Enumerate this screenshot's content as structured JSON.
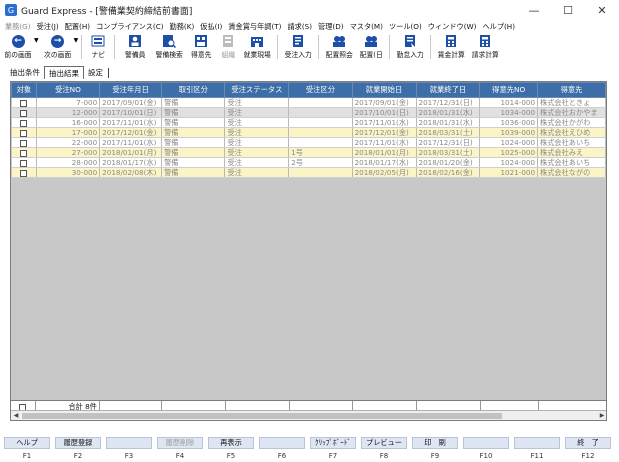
{
  "window": {
    "title": "Guard Express - [警備業契約締結前書面]",
    "controls": [
      "—",
      "☐",
      "✕"
    ]
  },
  "menu": [
    {
      "label": "業務(G)",
      "disabled": true
    },
    {
      "label": "受注(J)",
      "disabled": false
    },
    {
      "label": "配置(H)",
      "disabled": false
    },
    {
      "label": "コンプライアンス(C)",
      "disabled": false
    },
    {
      "label": "勤務(K)",
      "disabled": false
    },
    {
      "label": "仮払(I)",
      "disabled": false
    },
    {
      "label": "賃金賞与年調(T)",
      "disabled": false
    },
    {
      "label": "請求(S)",
      "disabled": false
    },
    {
      "label": "管理(D)",
      "disabled": false
    },
    {
      "label": "マスタ(M)",
      "disabled": false
    },
    {
      "label": "ツール(O)",
      "disabled": false
    },
    {
      "label": "ウィンドウ(W)",
      "disabled": false
    },
    {
      "label": "ヘルプ(H)",
      "disabled": false
    }
  ],
  "toolbar": {
    "back": "前の画面",
    "forward": "次の画面",
    "navi": "ナビ",
    "guard": "警備員",
    "guard_search": "警備検索",
    "client": "得意先",
    "chart": "組織",
    "site": "就業現場",
    "order_entry": "受注入力",
    "assignment_view": "配置照会",
    "assignment_day": "配置(日",
    "attendance_entry": "勤怠入力",
    "wage_calc": "賃金計算",
    "billing_calc": "請求計算"
  },
  "tabs": {
    "conditions": "抽出条件",
    "results": "抽出結果",
    "settings": "設定"
  },
  "table": {
    "columns": [
      "対象",
      "受注NO",
      "受注年月日",
      "取引区分",
      "受注ステータス",
      "受注区分",
      "就業開始日",
      "就業終了日",
      "得意先NO",
      "得意先"
    ],
    "rows": [
      {
        "style": "white",
        "no": "7-000",
        "date": "2017/09/01(金)",
        "type": "警備",
        "status": "受注",
        "category": "",
        "start": "2017/09/01(金)",
        "end": "2017/12/31(日)",
        "client_no": "1014-000",
        "client": "株式会社ときょ"
      },
      {
        "style": "gray",
        "no": "12-000",
        "date": "2017/10/01(日)",
        "type": "警備",
        "status": "受注",
        "category": "",
        "start": "2017/10/01(日)",
        "end": "2018/01/31(水)",
        "client_no": "1034-000",
        "client": "株式会社おかやま"
      },
      {
        "style": "white",
        "no": "16-000",
        "date": "2017/11/01(水)",
        "type": "警備",
        "status": "受注",
        "category": "",
        "start": "2017/11/01(水)",
        "end": "2018/01/31(水)",
        "client_no": "1036-000",
        "client": "株式会社かがわ"
      },
      {
        "style": "cream",
        "no": "17-000",
        "date": "2017/12/01(金)",
        "type": "警備",
        "status": "受注",
        "category": "",
        "start": "2017/12/01(金)",
        "end": "2018/03/31(土)",
        "client_no": "1039-000",
        "client": "株式会社えひめ"
      },
      {
        "style": "white",
        "no": "22-000",
        "date": "2017/11/01(水)",
        "type": "警備",
        "status": "受注",
        "category": "",
        "start": "2017/11/01(水)",
        "end": "2017/12/31(日)",
        "client_no": "1024-000",
        "client": "株式会社あいち"
      },
      {
        "style": "cream",
        "no": "27-000",
        "date": "2018/01/01(月)",
        "type": "警備",
        "status": "受注",
        "category": "1号",
        "start": "2018/01/01(月)",
        "end": "2018/03/31(土)",
        "client_no": "1025-000",
        "client": "株式会社みえ"
      },
      {
        "style": "white",
        "no": "28-000",
        "date": "2018/01/17(水)",
        "type": "警備",
        "status": "受注",
        "category": "2号",
        "start": "2018/01/17(水)",
        "end": "2018/01/20(金)",
        "client_no": "1024-000",
        "client": "株式会社あいち"
      },
      {
        "style": "cream",
        "no": "30-000",
        "date": "2018/02/08(木)",
        "type": "警備",
        "status": "受注",
        "category": "",
        "start": "2018/02/05(月)",
        "end": "2018/02/16(金)",
        "client_no": "1021-000",
        "client": "株式会社ながの"
      }
    ],
    "total_label": "合計 8件"
  },
  "fkeys": [
    {
      "label": "ヘルプ",
      "key": "F1",
      "disabled": false
    },
    {
      "label": "履歴登録",
      "key": "F2",
      "disabled": false
    },
    {
      "label": "",
      "key": "F3",
      "disabled": false
    },
    {
      "label": "履歴削除",
      "key": "F4",
      "disabled": true
    },
    {
      "label": "再表示",
      "key": "F5",
      "disabled": false
    },
    {
      "label": "",
      "key": "F6",
      "disabled": false
    },
    {
      "label": "ｸﾘｯﾌﾟﾎﾞｰﾄﾞ",
      "key": "F7",
      "disabled": false
    },
    {
      "label": "プレビュー",
      "key": "F8",
      "disabled": false
    },
    {
      "label": "印　刷",
      "key": "F9",
      "disabled": false
    },
    {
      "label": "",
      "key": "F10",
      "disabled": false
    },
    {
      "label": "",
      "key": "F11",
      "disabled": false
    },
    {
      "label": "終　了",
      "key": "F12",
      "disabled": false
    }
  ],
  "colors": {
    "header_blue": "#3e6ea8",
    "row_cream": "#fbf4c6",
    "row_gray": "#e0e0e0",
    "grid_bg": "#c8c8c8",
    "icon_blue": "#1d4fa8"
  }
}
